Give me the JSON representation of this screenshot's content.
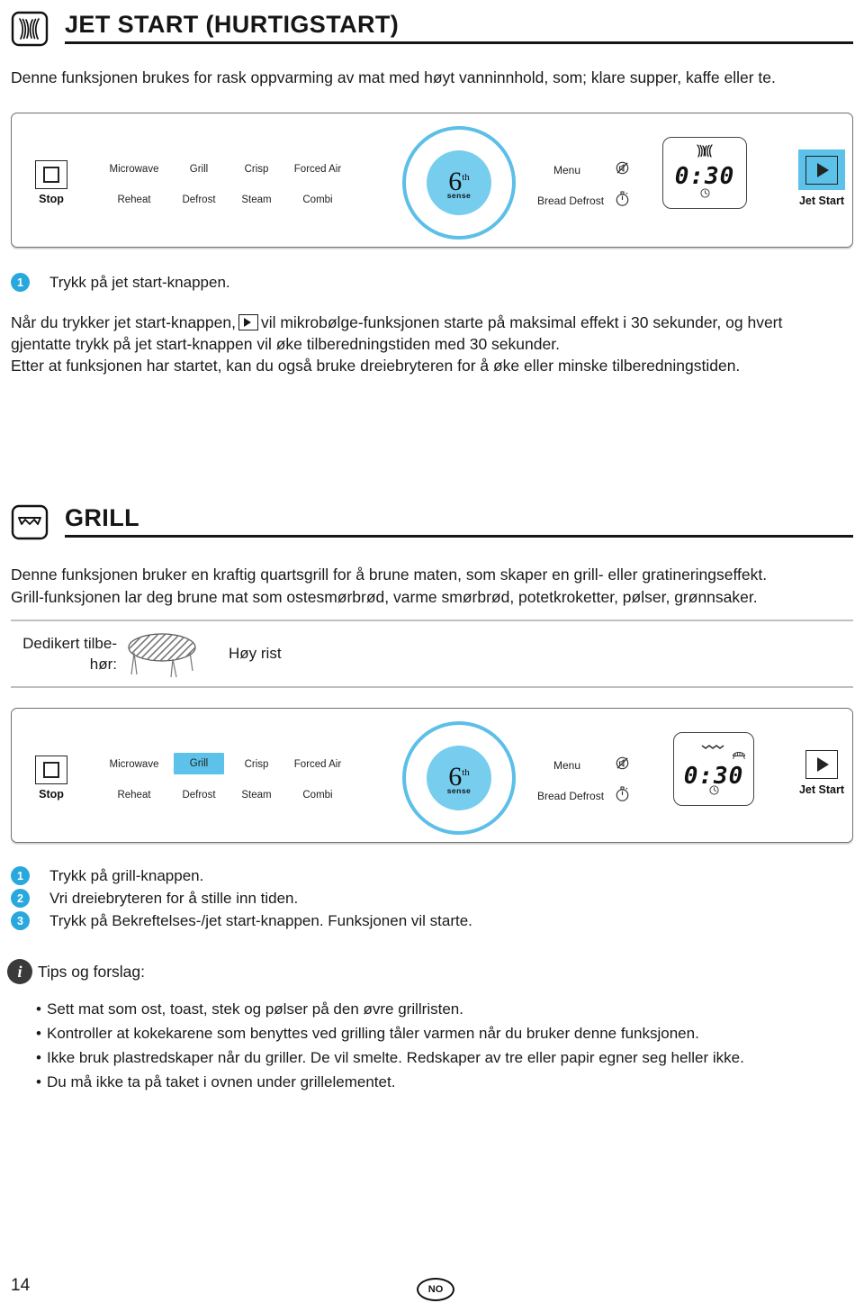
{
  "sections": [
    {
      "id": "jet-start",
      "icon": "microwave-waves-icon",
      "title": "JET START (HURTIGSTART)",
      "intro": "Denne funksjonen brukes for rask oppvarming av mat med høyt vanninnhold, som; klare supper, kaffe eller te.",
      "body_lines": [
        "Når du trykker jet start-knappen,",
        "vil mikrobølge-funksjonen starte på maksimal effekt i 30 sekunder, og hvert",
        "gjentatte trykk på jet start-knappen vil øke tilberedningstiden med 30 sekunder.",
        "Etter at funksjonen har startet, kan du også bruke dreiebryteren for å øke eller minske tilberedningstiden."
      ],
      "steps": [
        {
          "num": "1",
          "text": "Trykk på jet start-knappen."
        }
      ]
    },
    {
      "id": "grill",
      "icon": "grill-element-icon",
      "title": "GRILL",
      "body_lines": [
        "Denne funksjonen bruker en kraftig quartsgrill for å brune maten, som skaper en grill- eller gratineringseffekt.",
        "Grill-funksjonen lar deg brune mat som ostesmørbrød, varme smørbrød, potetkroketter, pølser, grønnsaker."
      ],
      "accessory": {
        "label_line1": "Dedikert tilbe-",
        "label_line2": "hør:",
        "art": "high-rack-icon",
        "name": "Høy rist"
      },
      "steps": [
        {
          "num": "1",
          "text": "Trykk på grill-knappen."
        },
        {
          "num": "2",
          "text": "Vri dreiebryteren for å stille inn tiden."
        },
        {
          "num": "3",
          "text": "Trykk på Bekreftelses-/jet start-knappen. Funksjonen vil starte."
        }
      ]
    }
  ],
  "panel": {
    "stop_label": "Stop",
    "stop_icon": "stop-square-icon",
    "modes_row1": [
      "Microwave",
      "Grill",
      "Crisp",
      "Forced Air"
    ],
    "modes_row2": [
      "Reheat",
      "Defrost",
      "Steam",
      "Combi"
    ],
    "dial": {
      "numeral": "6",
      "ordinal": "th",
      "word": "sense"
    },
    "menu_label": "Menu",
    "menu_icon": "sound-off-icon",
    "bread_defrost_label": "Bread Defrost",
    "bread_defrost_icon": "timer-icon",
    "display": {
      "time": "0:30",
      "top_icon": "microwave-waves-icon",
      "bottom_icon": "clock-icon"
    },
    "jet_start_label": "Jet Start",
    "jet_start_icon": "play-triangle-icon"
  },
  "panel1": {
    "highlight_mode": null,
    "jet_highlighted": true,
    "display_top_icon": "microwave-waves-icon",
    "display_corner_icon": null
  },
  "panel2": {
    "highlight_mode": "Grill",
    "jet_highlighted": false,
    "display_top_icon": "grill-zigzag-icon",
    "display_corner_icon": "rack-icon"
  },
  "tips": {
    "icon": "info-icon",
    "title": "Tips og forslag:",
    "items": [
      "Sett mat som ost, toast, stek og pølser på den øvre grillristen.",
      "Kontroller at kokekarene som benyttes ved grilling tåler varmen når du bruker denne funksjonen.",
      "Ikke bruk plastredskaper når du griller. De vil smelte. Redskaper av tre eller papir egner seg heller ikke.",
      "Du må ikke ta på taket i ovnen under grillelementet."
    ]
  },
  "footer": {
    "page_number": "14",
    "language_code": "NO"
  },
  "colors": {
    "accent_blue": "#5cc2e9",
    "dial_blue": "#76cdee",
    "ring_blue": "#5cbfe8",
    "step_blue": "#29a8dd",
    "rule_dark": "#161616"
  }
}
